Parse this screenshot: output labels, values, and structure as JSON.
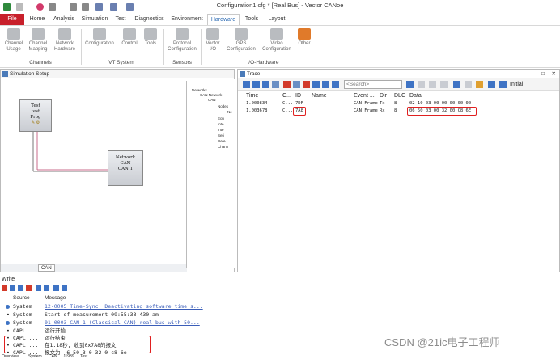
{
  "window_title": "Configuration1.cfg * [Real Bus] - Vector CANoe",
  "ribbon_tabs": [
    "File",
    "Home",
    "Analysis",
    "Simulation",
    "Test",
    "Diagnostics",
    "Environment",
    "Hardware",
    "Tools",
    "Layout"
  ],
  "active_tab": "Hardware",
  "ribbon": {
    "channels": {
      "group": "Channels",
      "buttons": [
        "Channel Usage",
        "Channel Mapping",
        "Network Hardware"
      ]
    },
    "vt_system": {
      "group": "VT System",
      "buttons": [
        "Configuration",
        "Control",
        "Tools"
      ]
    },
    "sensors": {
      "group": "Sensors",
      "buttons": [
        "Protocol Configuration"
      ]
    },
    "io_hardware": {
      "group": "I/O-Hardware",
      "buttons": [
        "Vector I/O",
        "GPS Configuration",
        "Video Configuration",
        "Other"
      ]
    }
  },
  "simulation_setup": {
    "title": "Simulation Setup",
    "node_lines": [
      "Test",
      "test",
      "Prog"
    ],
    "network_lines": [
      "Network",
      "CAN",
      "CAN 1"
    ],
    "bottom_tab": "CAN",
    "tree": [
      "Networks",
      "CAN Network",
      "CAN",
      "Nodes",
      "Ne",
      "Ecu",
      "Inte",
      "Inte",
      "Seri",
      "Data",
      "Chann"
    ]
  },
  "trace": {
    "title": "Trace",
    "search_placeholder": "<Search>",
    "layout_label": "Initial",
    "columns": [
      "Time",
      "C...",
      "ID",
      "Name",
      "Event ...",
      "Dir",
      "DLC",
      "Data"
    ],
    "rows": [
      {
        "time": "1.000834",
        "chn": "C...",
        "id": "7DF",
        "name": "",
        "event": "CAN Frame",
        "dir": "Tx",
        "dlc": "8",
        "data": "02 10 03 00 00 00 00 00"
      },
      {
        "time": "1.003678",
        "chn": "C...",
        "id": "7A8",
        "name": "",
        "event": "CAN Frame",
        "dir": "Rx",
        "dlc": "8",
        "data": "06 50 03 00 32 00 C8 6E"
      }
    ]
  },
  "write": {
    "title": "Write",
    "columns": [
      "Source",
      "Message"
    ],
    "rows": [
      {
        "icon": "info",
        "source": "System",
        "message": "12-0005 Time-Sync: Deactivating software time s..."
      },
      {
        "icon": "bullet",
        "source": "System",
        "message": "Start of measurement 09:55:33.430 am"
      },
      {
        "icon": "info",
        "source": "System",
        "message": "01-0003 CAN 1 (Classical CAN)  real bus with 50..."
      },
      {
        "icon": "bullet",
        "source": "CAPL ...",
        "message": "运行开始"
      },
      {
        "icon": "bullet",
        "source": "CAPL ...",
        "message": "运行结束"
      },
      {
        "icon": "bullet",
        "source": "CAPL ...",
        "message": "在1.18秒, 收到0x7A8的报文"
      },
      {
        "icon": "bullet",
        "source": "CAPL ...",
        "message": "报文为: 6 50 3 0 32 0 c8 6e"
      }
    ],
    "bottom_tabs": [
      "Overview",
      "System",
      "CAN",
      "J1939",
      "Test"
    ]
  },
  "watermark": "CSDN @21ic电子工程师",
  "colors": {
    "file_tab": "#c8202b",
    "active_tab_text": "#2d6bb3",
    "highlight": "#e02020",
    "info": "#3e73c4"
  }
}
